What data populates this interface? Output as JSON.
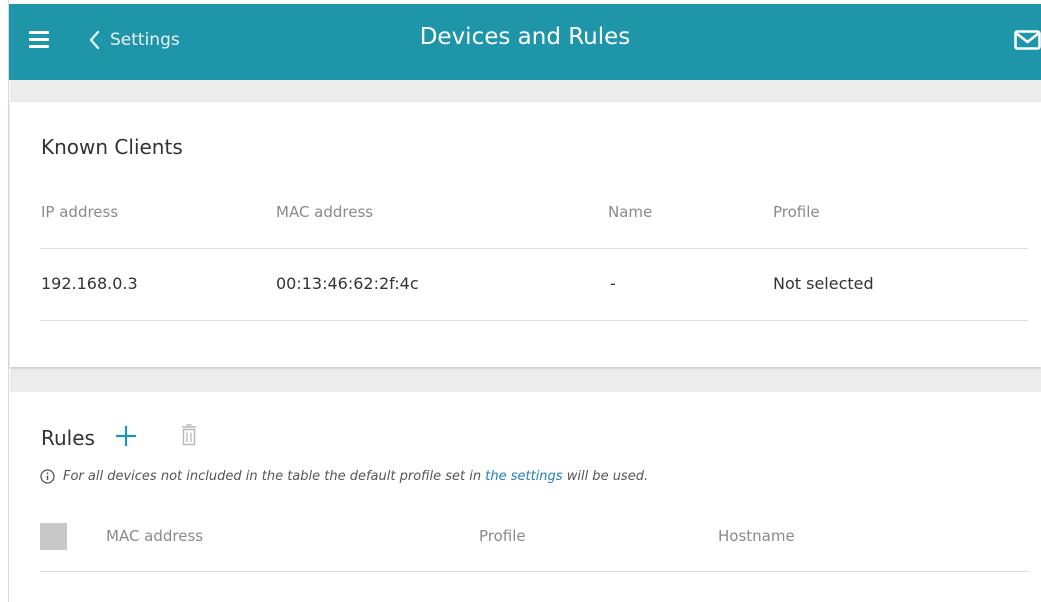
{
  "header": {
    "title": "Devices and Rules",
    "back_label": "Settings",
    "bg_color": "#1f95aa"
  },
  "known_clients": {
    "title": "Known Clients",
    "columns": {
      "ip": "IP address",
      "mac": "MAC address",
      "name": "Name",
      "profile": "Profile"
    },
    "rows": [
      {
        "ip": "192.168.0.3",
        "mac": "00:13:46:62:2f:4c",
        "name": "-",
        "profile": "Not selected"
      }
    ]
  },
  "rules": {
    "title": "Rules",
    "note_prefix": "For all devices not included in the table the default profile set in ",
    "note_link": "the settings",
    "note_suffix": " will be used.",
    "columns": {
      "mac": "MAC address",
      "profile": "Profile",
      "hostname": "Hostname"
    }
  },
  "icons": {
    "menu": "hamburger-menu-icon",
    "back": "chevron-left-icon",
    "mail": "envelope-icon",
    "add": "plus-icon",
    "delete": "trash-icon",
    "info": "info-circle-icon"
  },
  "colors": {
    "accent": "#1f95aa",
    "link": "#1f7fbf"
  }
}
